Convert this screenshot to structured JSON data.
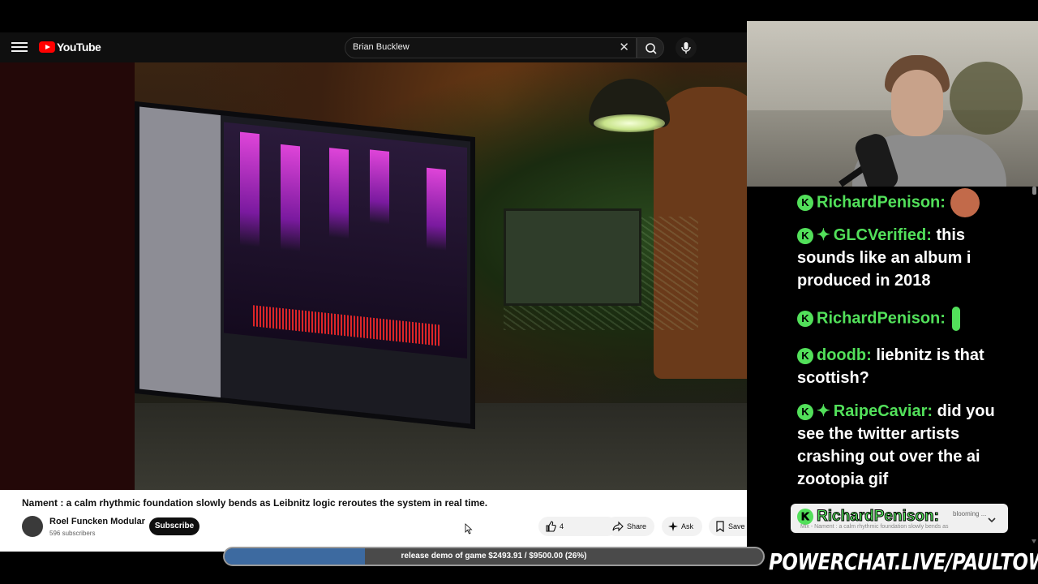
{
  "masthead": {
    "logo_text": "YouTube",
    "search_value": "Brian Bucklew"
  },
  "video": {
    "title": "Nament : a calm rhythmic foundation slowly bends as Leibnitz logic reroutes the system in real time.",
    "channel_name": "Roel Funcken Modular",
    "subscribers": "596 subscribers",
    "subscribe_label": "Subscribe",
    "like_count": "4",
    "share_label": "Share",
    "ask_label": "Ask",
    "save_label": "Save",
    "more_label": "..."
  },
  "chat": {
    "messages": [
      {
        "user": "RichardPenison:",
        "text": "",
        "emote": "face"
      },
      {
        "user": "GLCVerified:",
        "text": "this sounds like an album i produced in 2018",
        "sparkle": true
      },
      {
        "user": "RichardPenison:",
        "text": "",
        "emote": "figure"
      },
      {
        "user": "doodb:",
        "text": "liebnitz is that scottish?"
      },
      {
        "user": "RaipeCaviar:",
        "text": "did you see the twitter artists crashing out over the ai zootopia gif",
        "sparkle": true
      }
    ],
    "popup_user": "RichardPenison:",
    "popup_snippet": "blooming ...",
    "popup_sub": "Mix - Nament : a calm rhythmic foundation slowly bends as"
  },
  "goal": {
    "text": "release demo of game $2493.91 / $9500.00 (26%)",
    "progress": 0.26
  },
  "brand_text": "POWERCHAT.LIVE/PAULTOWN",
  "colors": {
    "chat_user": "#52e05a",
    "goal_fill": "#3d6aa0",
    "yt_red": "#ff0000"
  }
}
